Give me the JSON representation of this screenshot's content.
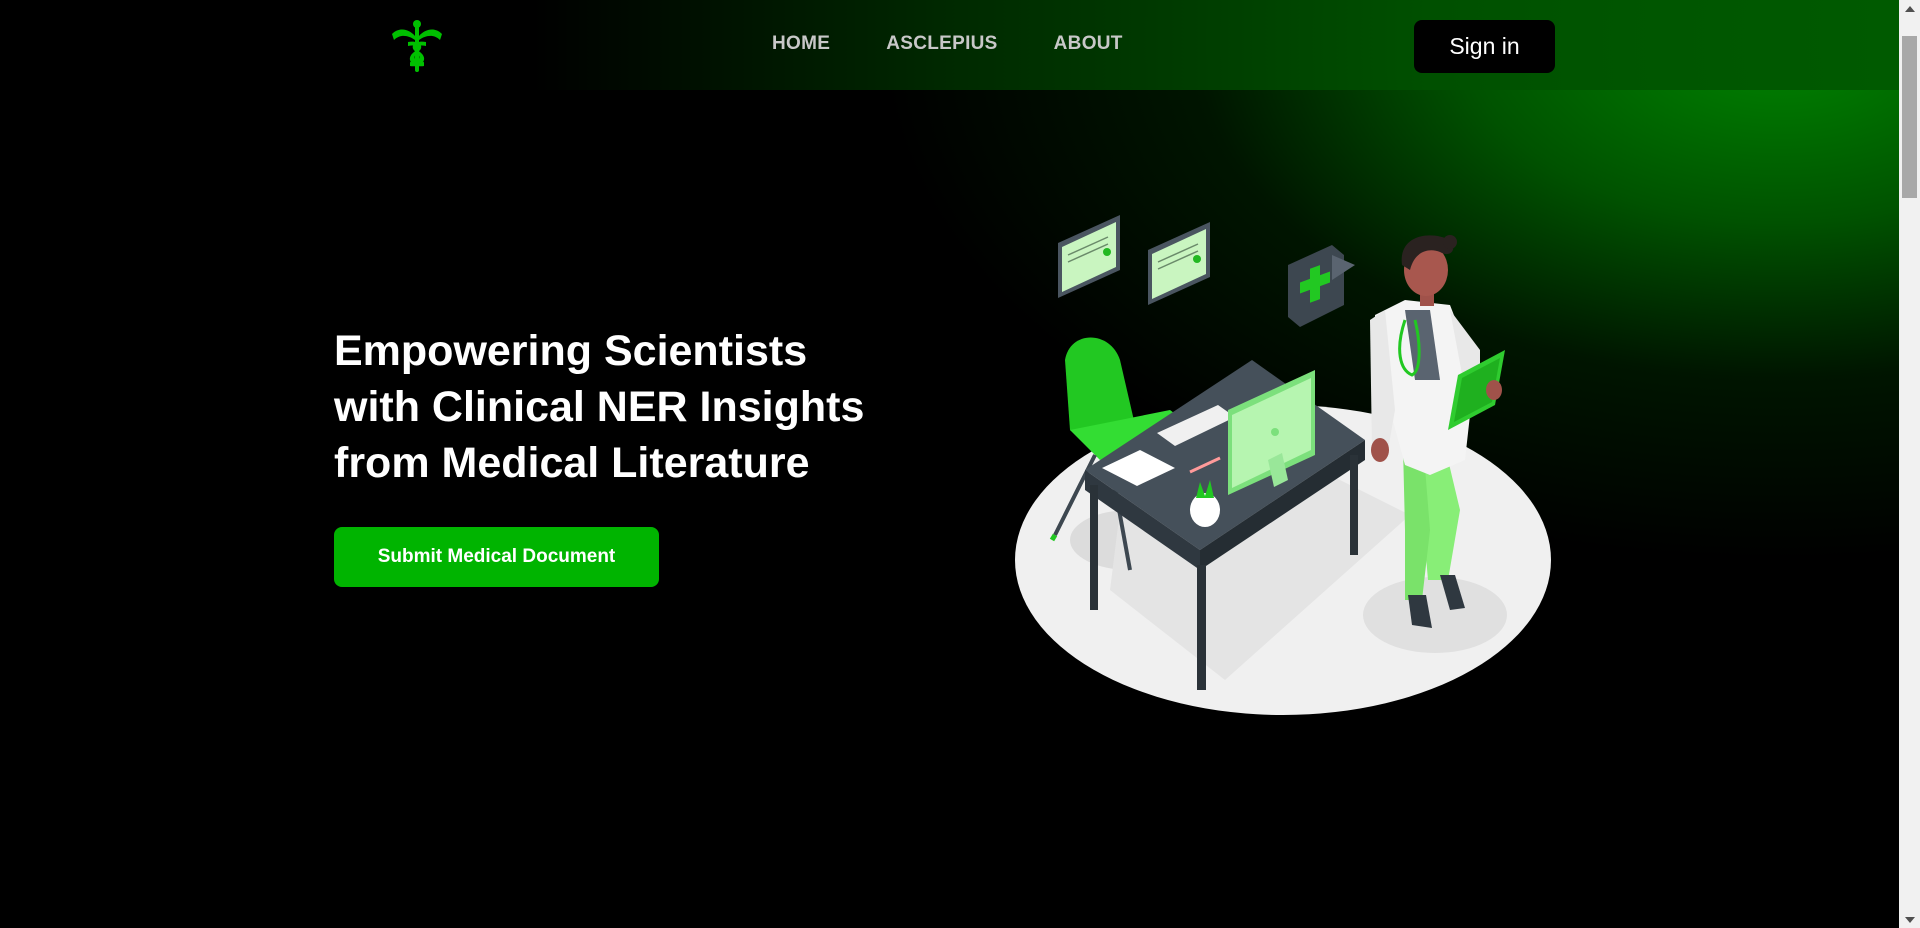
{
  "nav": {
    "logo_icon": "caduceus-icon",
    "links": [
      {
        "label": "HOME"
      },
      {
        "label": "ASCLEPIUS"
      },
      {
        "label": "ABOUT"
      }
    ],
    "signin_label": "Sign in"
  },
  "hero": {
    "title_lines": [
      "Empowering Scientists",
      "with Clinical NER Insights",
      "from Medical Literature"
    ],
    "cta_label": "Submit Medical Document",
    "illustration": "doctor-at-desk-illustration"
  },
  "colors": {
    "accent": "#00b400",
    "background": "#000000",
    "glow": "#008c00"
  }
}
